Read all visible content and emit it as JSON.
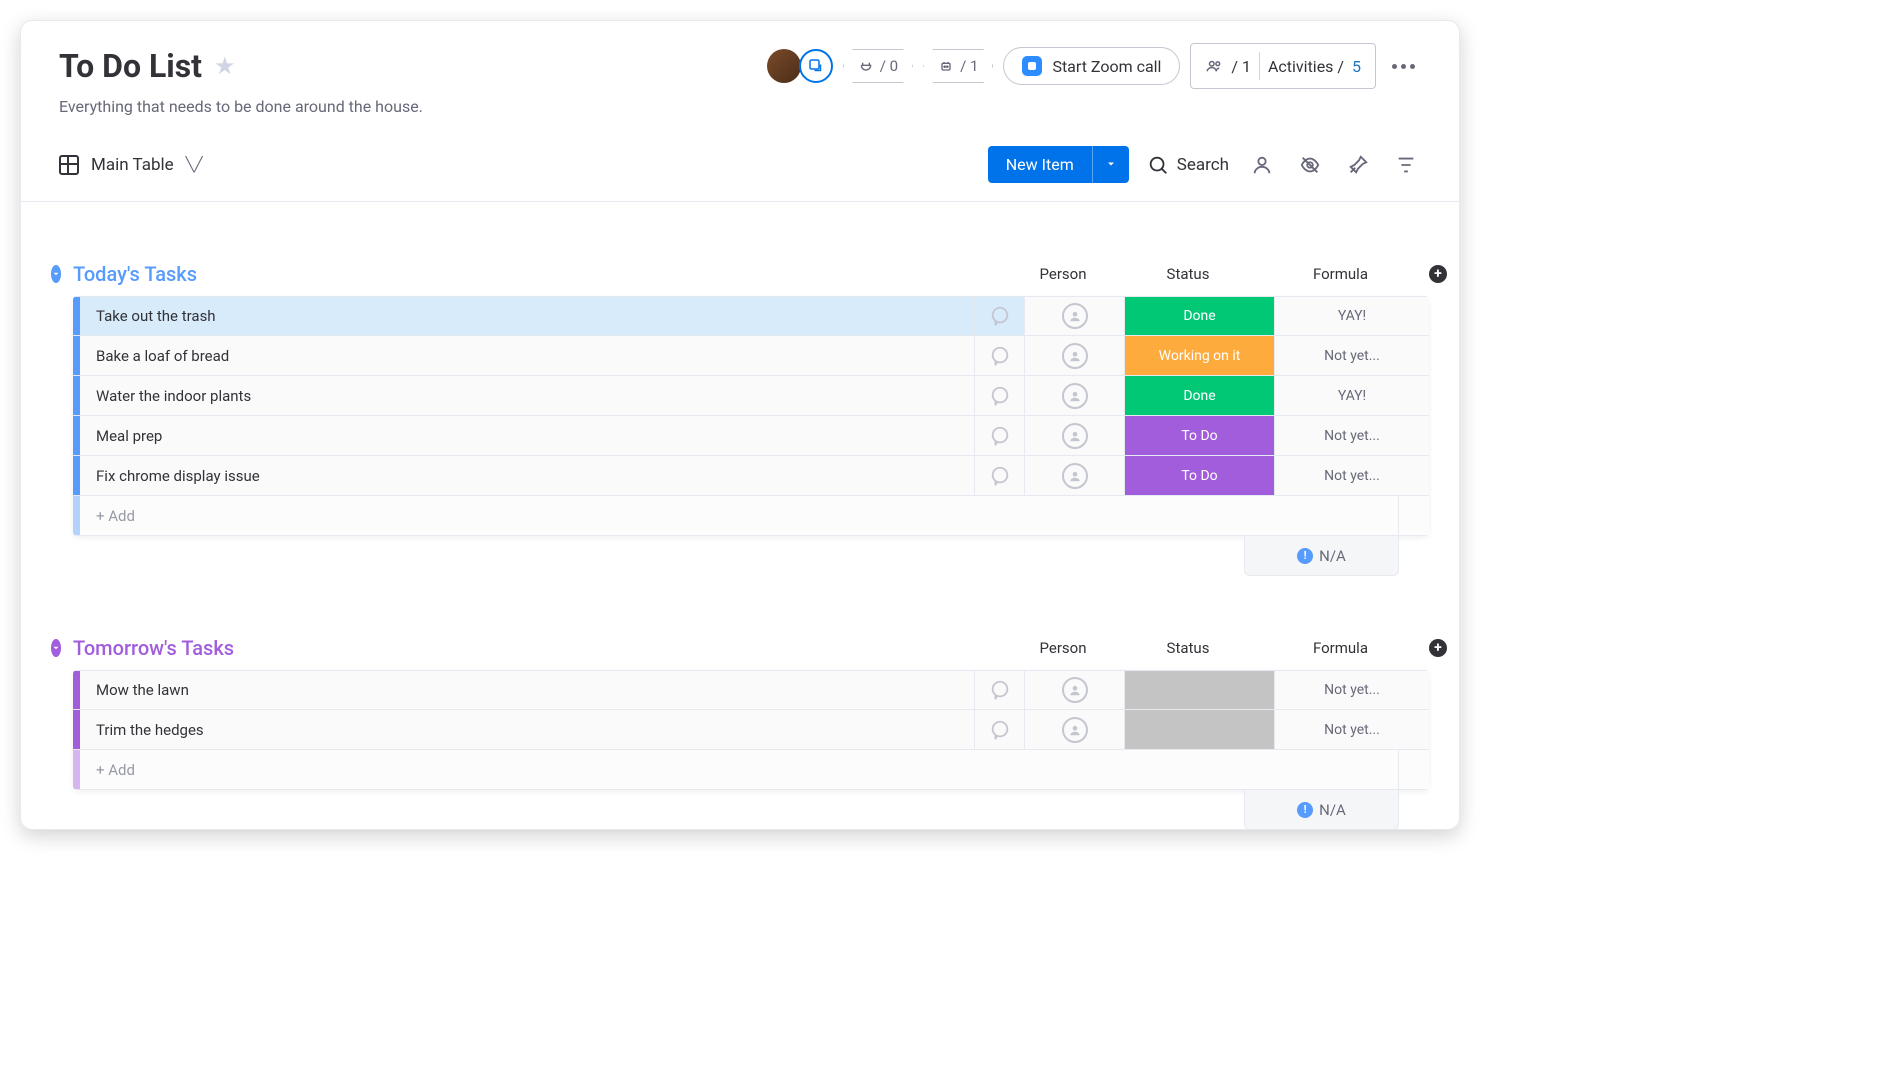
{
  "header": {
    "title": "To Do List",
    "subtitle": "Everything that needs to be done around the house.",
    "integrations_count": "/ 0",
    "automations_count": "/ 1",
    "zoom_label": "Start Zoom call",
    "members_count": "/ 1",
    "activities_label": "Activities /",
    "activities_count": "5"
  },
  "toolbar": {
    "view_label": "Main Table",
    "new_item_label": "New Item",
    "search_label": "Search"
  },
  "columns": {
    "person": "Person",
    "status": "Status",
    "formula": "Formula"
  },
  "groups": [
    {
      "id": "today",
      "title": "Today's Tasks",
      "color": "blue",
      "color_hex": "#579bfc",
      "rows": [
        {
          "name": "Take out the trash",
          "status": "Done",
          "status_class": "st-done",
          "formula": "YAY!",
          "selected": true
        },
        {
          "name": "Bake a loaf of bread",
          "status": "Working on it",
          "status_class": "st-working",
          "formula": "Not yet...",
          "selected": false
        },
        {
          "name": "Water the indoor plants",
          "status": "Done",
          "status_class": "st-done",
          "formula": "YAY!",
          "selected": false
        },
        {
          "name": "Meal prep",
          "status": "To Do",
          "status_class": "st-todo",
          "formula": "Not yet...",
          "selected": false
        },
        {
          "name": "Fix chrome display issue",
          "status": "To Do",
          "status_class": "st-todo",
          "formula": "Not yet...",
          "selected": false
        }
      ],
      "add_label": "+ Add",
      "footer_formula": "N/A"
    },
    {
      "id": "tomorrow",
      "title": "Tomorrow's Tasks",
      "color": "purple",
      "color_hex": "#a25ddc",
      "rows": [
        {
          "name": "Mow the lawn",
          "status": "",
          "status_class": "st-empty",
          "formula": "Not yet...",
          "selected": false
        },
        {
          "name": "Trim the hedges",
          "status": "",
          "status_class": "st-empty",
          "formula": "Not yet...",
          "selected": false
        }
      ],
      "add_label": "+ Add",
      "footer_formula": "N/A"
    }
  ]
}
